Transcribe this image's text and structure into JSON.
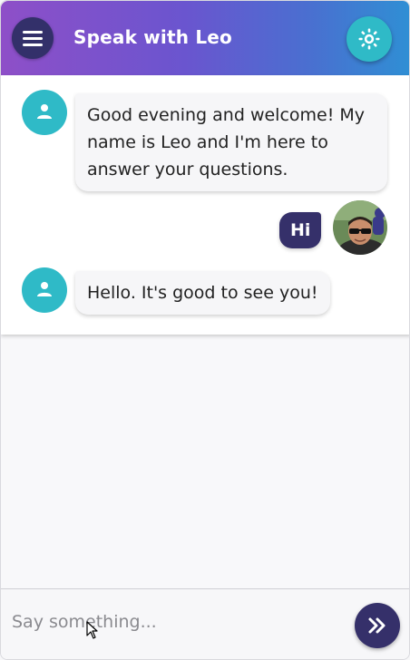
{
  "header": {
    "title": "Speak with Leo",
    "menu_icon": "hamburger-menu-icon",
    "theme_icon": "sun-icon"
  },
  "messages": [
    {
      "sender": "bot",
      "text": "Good evening and welcome! My name is Leo and I'm here to answer your questions."
    },
    {
      "sender": "user",
      "text": "Hi"
    },
    {
      "sender": "bot",
      "text": "Hello. It's good to see you!"
    }
  ],
  "input": {
    "placeholder": "Say something...",
    "value": "",
    "send_icon": "double-chevron-right-icon"
  },
  "colors": {
    "header_gradient_start": "#8e4fc8",
    "header_gradient_end": "#2f8fd4",
    "accent_teal": "#2fbac7",
    "dark_navy": "#35306a"
  }
}
